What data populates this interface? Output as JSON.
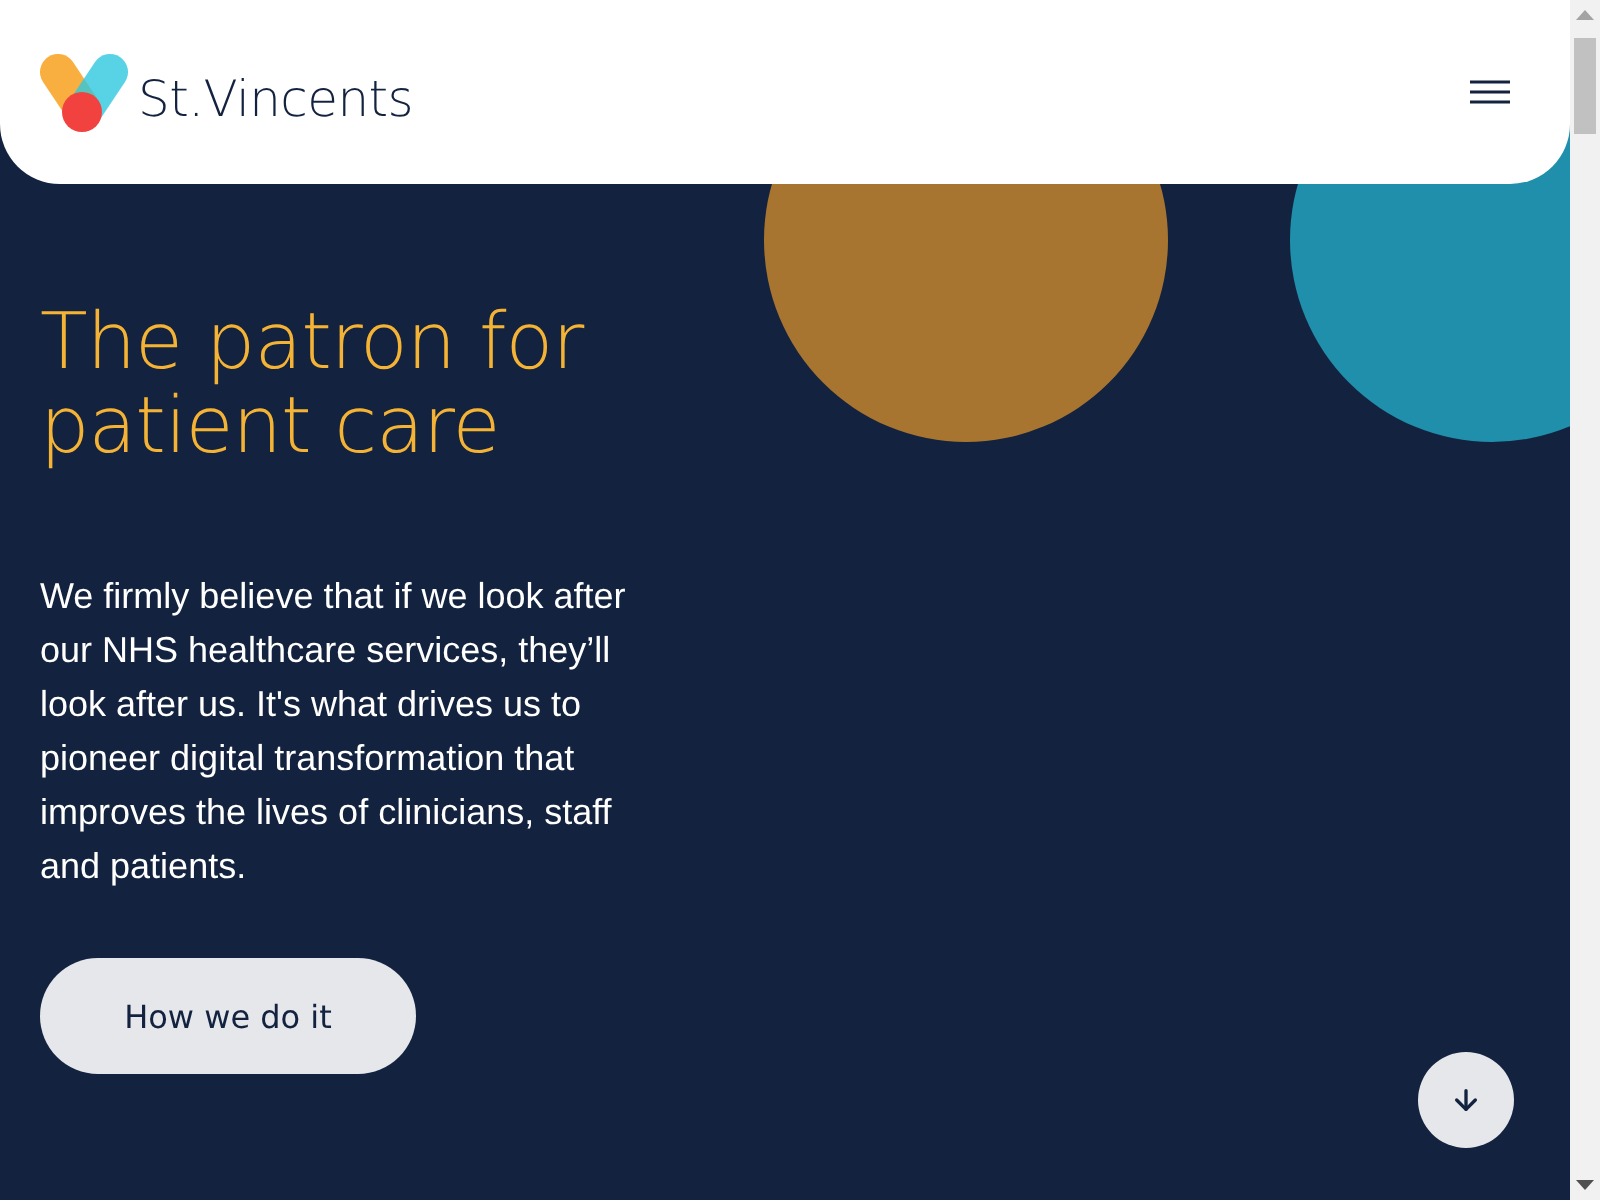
{
  "header": {
    "logo_text": "St.Vincents"
  },
  "hero": {
    "heading": "The patron for patient care",
    "body": "We firmly believe that if we look after our NHS healthcare services, they’ll look after us. It's what drives us to pioneer digital transformation that improves the lives of clinicians, staff and patients.",
    "cta": "How we do it"
  }
}
